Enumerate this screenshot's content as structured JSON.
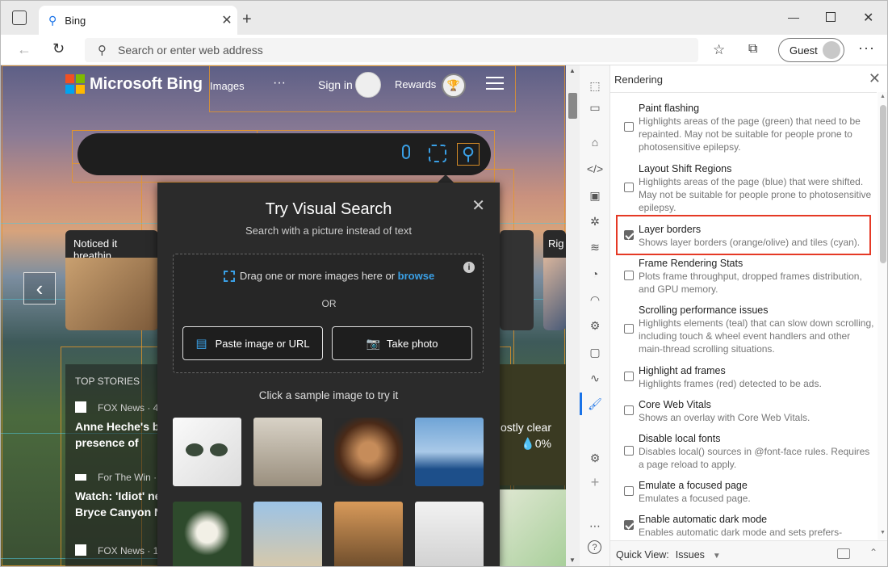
{
  "tab": {
    "title": "Bing"
  },
  "address": {
    "placeholder": "Search or enter web address"
  },
  "profile": {
    "label": "Guest"
  },
  "bing": {
    "logo_text": "Microsoft Bing",
    "nav_images": "Images",
    "nav_more": "···",
    "sign_in": "Sign in",
    "rewards": "Rewards"
  },
  "cards": {
    "card1": "Noticed it breathin",
    "card3": "Rig"
  },
  "news": {
    "heading": "TOP STORIES",
    "items": [
      {
        "source": "FOX News · 4",
        "headline": "Anne Heche's bl presence of drug"
      },
      {
        "source": "For The Win · ",
        "headline": "Watch: 'Idiot' ne Bryce Canyon N"
      },
      {
        "source": "FOX News · 1",
        "headline": ""
      }
    ],
    "weather_text": "Mostly clear",
    "weather_precip": "0%"
  },
  "visual_search": {
    "title": "Try Visual Search",
    "subtitle": "Search with a picture instead of text",
    "drag_text": "Drag one or more images here or",
    "browse": "browse",
    "or": "OR",
    "paste_button": "Paste image or URL",
    "photo_button": "Take photo",
    "sample_prompt": "Click a sample image to try it"
  },
  "devtools": {
    "panel_title": "Rendering",
    "options": [
      {
        "title": "Paint flashing",
        "desc": "Highlights areas of the page (green) that need to be repainted. May not be suitable for people prone to photosensitive epilepsy.",
        "checked": false
      },
      {
        "title": "Layout Shift Regions",
        "desc": "Highlights areas of the page (blue) that were shifted. May not be suitable for people prone to photosensitive epilepsy.",
        "checked": false
      },
      {
        "title": "Layer borders",
        "desc": "Shows layer borders (orange/olive) and tiles (cyan).",
        "checked": true
      },
      {
        "title": "Frame Rendering Stats",
        "desc": "Plots frame throughput, dropped frames distribution, and GPU memory.",
        "checked": false
      },
      {
        "title": "Scrolling performance issues",
        "desc": "Highlights elements (teal) that can slow down scrolling, including touch & wheel event handlers and other main-thread scrolling situations.",
        "checked": false
      },
      {
        "title": "Highlight ad frames",
        "desc": "Highlights frames (red) detected to be ads.",
        "checked": false
      },
      {
        "title": "Core Web Vitals",
        "desc": "Shows an overlay with Core Web Vitals.",
        "checked": false
      },
      {
        "title": "Disable local fonts",
        "desc": "Disables local() sources in @font-face rules. Requires a page reload to apply.",
        "checked": false
      },
      {
        "title": "Emulate a focused page",
        "desc": "Emulates a focused page.",
        "checked": false
      },
      {
        "title": "Enable automatic dark mode",
        "desc": "Enables automatic dark mode and sets prefers-",
        "checked": true
      }
    ],
    "quick_view_label": "Quick View:",
    "quick_view_value": "Issues"
  },
  "colors": {
    "highlight": "#e53925",
    "bing_blue": "#3aa0e6",
    "layer_border": "#e0962a",
    "tile": "#50c8dc"
  }
}
